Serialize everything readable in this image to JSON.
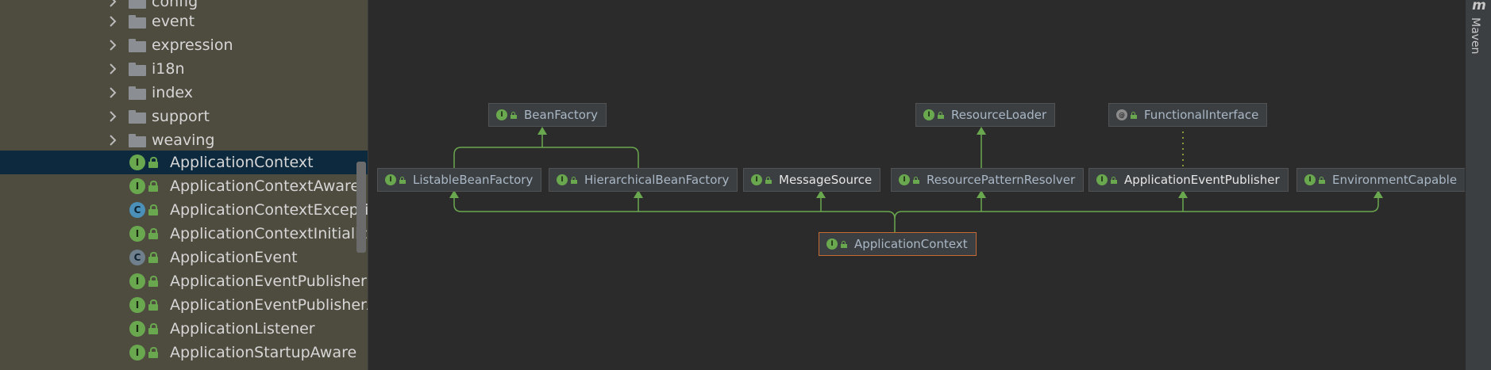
{
  "project_tree": {
    "folders": [
      {
        "label": "config"
      },
      {
        "label": "event"
      },
      {
        "label": "expression"
      },
      {
        "label": "i18n"
      },
      {
        "label": "index"
      },
      {
        "label": "support"
      },
      {
        "label": "weaving"
      }
    ],
    "classes": [
      {
        "label": "ApplicationContext",
        "kind": "I",
        "selected": true
      },
      {
        "label": "ApplicationContextAware",
        "kind": "I"
      },
      {
        "label": "ApplicationContextExceptio",
        "kind": "C"
      },
      {
        "label": "ApplicationContextInitializer",
        "kind": "I"
      },
      {
        "label": "ApplicationEvent",
        "kind": "C"
      },
      {
        "label": "ApplicationEventPublisher",
        "kind": "I"
      },
      {
        "label": "ApplicationEventPublisherAv",
        "kind": "I"
      },
      {
        "label": "ApplicationListener",
        "kind": "I"
      },
      {
        "label": "ApplicationStartupAware",
        "kind": "I"
      }
    ]
  },
  "diagram": {
    "nodes": {
      "bean_factory": {
        "label": "BeanFactory",
        "icon": "I"
      },
      "resource_loader": {
        "label": "ResourceLoader",
        "icon": "I"
      },
      "functional_interface": {
        "label": "FunctionalInterface",
        "icon": "@"
      },
      "listable_bean_factory": {
        "label": "ListableBeanFactory",
        "icon": "I"
      },
      "hierarchical_bean_factory": {
        "label": "HierarchicalBeanFactory",
        "icon": "I"
      },
      "message_source": {
        "label": "MessageSource",
        "icon": "I"
      },
      "resource_pattern_resolver": {
        "label": "ResourcePatternResolver",
        "icon": "I"
      },
      "application_event_publisher": {
        "label": "ApplicationEventPublisher",
        "icon": "I"
      },
      "environment_capable": {
        "label": "EnvironmentCapable",
        "icon": "I"
      },
      "application_context": {
        "label": "ApplicationContext",
        "icon": "I"
      }
    }
  },
  "tool_window": {
    "maven_label": "Maven",
    "maven_icon": "m"
  },
  "colors": {
    "tree_bg": "#4e4b3f",
    "selection": "#0d293e",
    "canvas_bg": "#2b2b2b",
    "edge": "#6aa84f",
    "focus_border": "#c66a33"
  }
}
